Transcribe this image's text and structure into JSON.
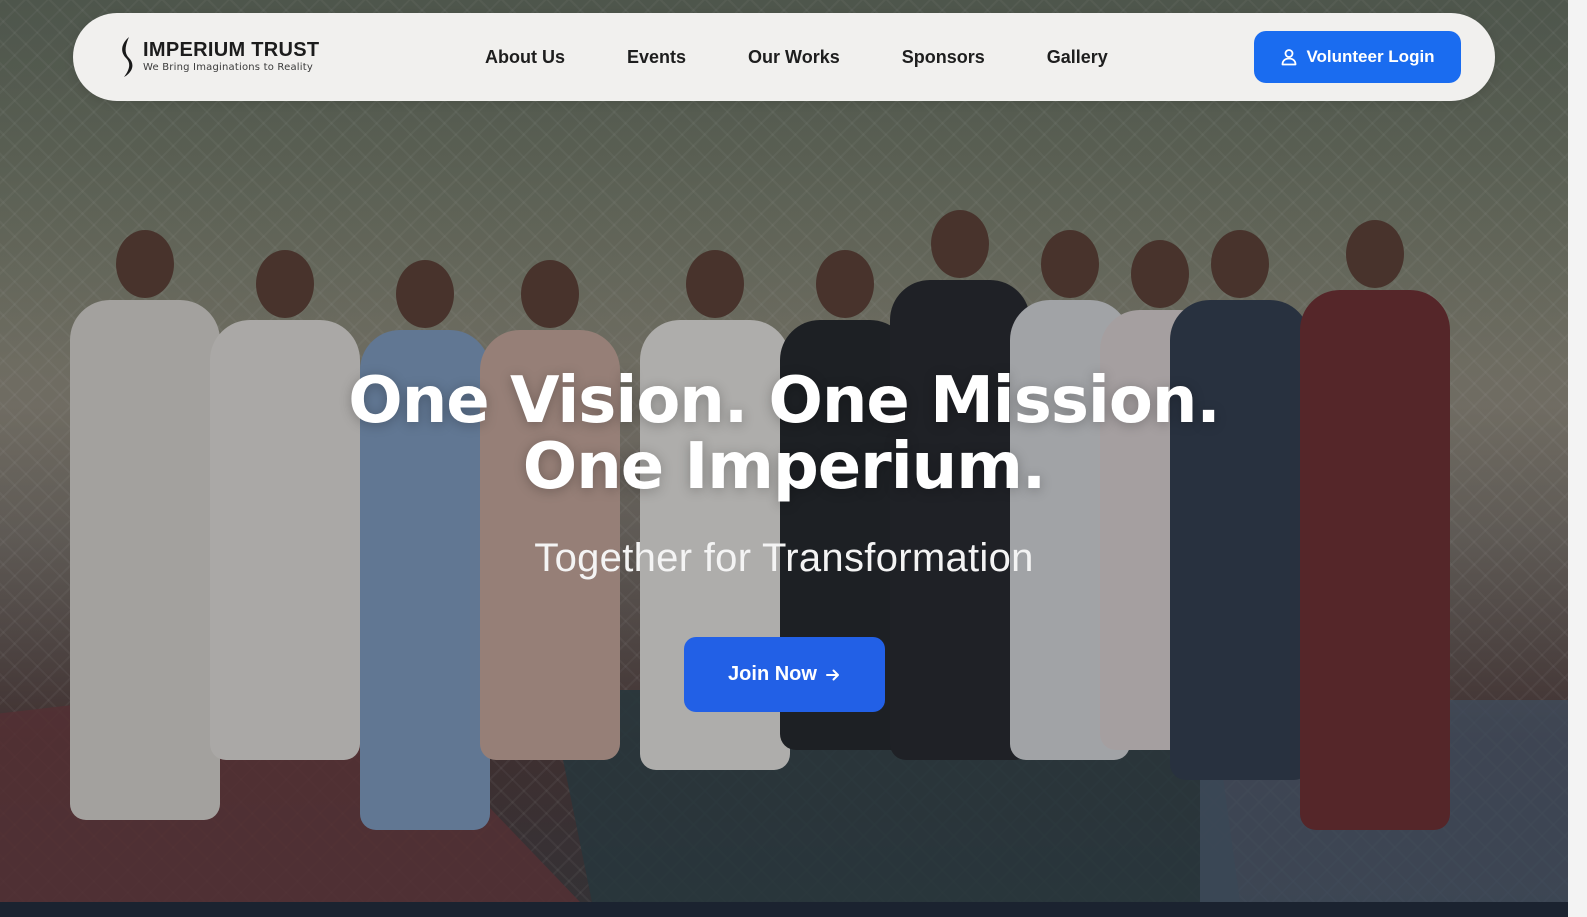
{
  "brand": {
    "title": "IMPERIUM TRUST",
    "tagline": "We Bring Imaginations to Reality",
    "logo_icon": "flame-s-icon"
  },
  "nav": {
    "links": [
      {
        "label": "About Us"
      },
      {
        "label": "Events"
      },
      {
        "label": "Our Works"
      },
      {
        "label": "Sponsors"
      },
      {
        "label": "Gallery"
      }
    ],
    "volunteer_button": {
      "label": "Volunteer Login",
      "icon": "user-icon"
    }
  },
  "hero": {
    "title_line1": "One Vision. One Mission.",
    "title_line2": "One Imperium.",
    "subtitle": "Together for Transformation",
    "cta": {
      "label": "Join Now",
      "icon": "arrow-right-icon"
    },
    "background": "group-photo"
  },
  "colors": {
    "accent": "#1a6cf0",
    "cta": "#2260e6",
    "navbar_bg": "#f1f0ee",
    "text_dark": "#1e1e1e"
  }
}
